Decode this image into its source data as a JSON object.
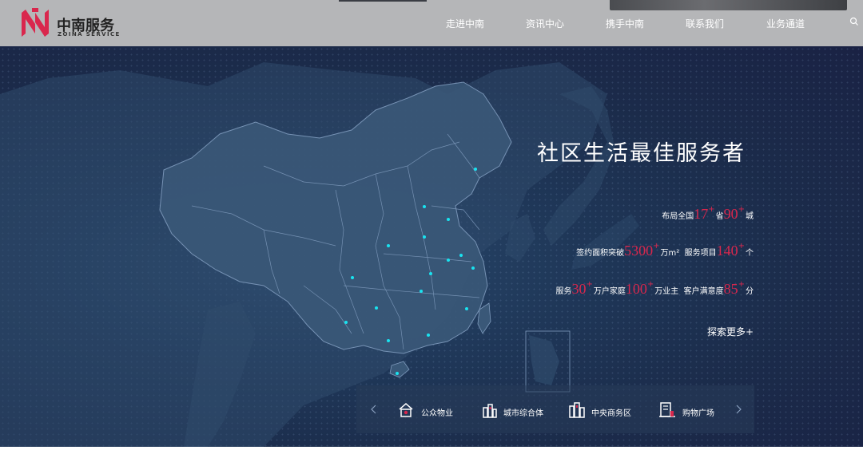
{
  "brand": {
    "name_cn": "中南服务",
    "name_en": "ZOINA SERVICE",
    "accent_color": "#d9274d"
  },
  "nav": {
    "items": [
      {
        "label": "走进中南"
      },
      {
        "label": "资讯中心"
      },
      {
        "label": "携手中南"
      },
      {
        "label": "联系我们"
      },
      {
        "label": "业务通道"
      }
    ],
    "search_icon": "search-icon"
  },
  "hero": {
    "slogan": "社区生活最佳服务者",
    "stats": {
      "line1": {
        "t1": "布局全国",
        "n1": "17",
        "t2": "省",
        "n2": "90",
        "t3": "城"
      },
      "line2": {
        "t1": "签约面积突破",
        "n1": "5300",
        "t2": "万m²",
        "t3": "服务项目",
        "n2": "140",
        "t4": "个"
      },
      "line3": {
        "t1": "服务",
        "n1": "30",
        "t2": "万户家庭",
        "n2": "100",
        "t3": "万业主",
        "t4": "客户满意度",
        "n3": "85",
        "t5": "分"
      },
      "plus": "+"
    },
    "explore_label": "探索更多+"
  },
  "categories": [
    {
      "label": "公众物业",
      "icon": "public-property-icon"
    },
    {
      "label": "城市综合体",
      "icon": "urban-complex-icon"
    },
    {
      "label": "中央商务区",
      "icon": "cbd-icon"
    },
    {
      "label": "购物广场",
      "icon": "shopping-plaza-icon"
    }
  ]
}
